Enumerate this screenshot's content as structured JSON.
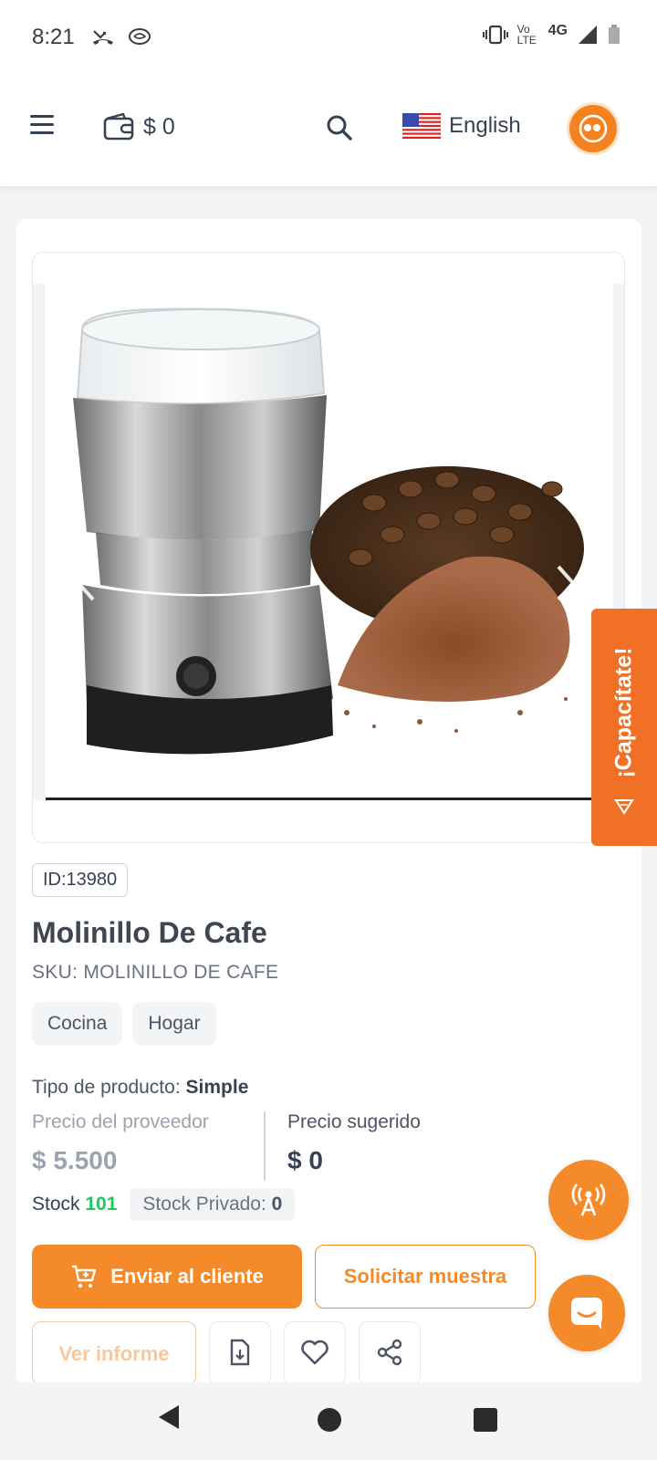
{
  "status": {
    "time": "8:21",
    "network": "4G",
    "volte": "Vo LTE"
  },
  "header": {
    "wallet_amount": "$ 0",
    "language": "English"
  },
  "product": {
    "id_label": "ID:13980",
    "title": "Molinillo De Cafe",
    "sku": "SKU: MOLINILLO DE CAFE",
    "tags": [
      "Cocina",
      "Hogar"
    ],
    "type_label": "Tipo de producto:",
    "type_value": "Simple",
    "supplier_price_label": "Precio del proveedor",
    "supplier_price": "$ 5.500",
    "suggested_price_label": "Precio sugerido",
    "suggested_price": "$ 0",
    "stock_label": "Stock",
    "stock_value": "101",
    "private_stock_label": "Stock Privado:",
    "private_stock_value": "0"
  },
  "actions": {
    "send_client": "Enviar al cliente",
    "request_sample": "Solicitar muestra",
    "view_report": "Ver informe"
  },
  "training_tab": "¡Capacítate!",
  "colors": {
    "accent": "#f58a2a",
    "training": "#f07025",
    "stock_green": "#22c55e"
  }
}
